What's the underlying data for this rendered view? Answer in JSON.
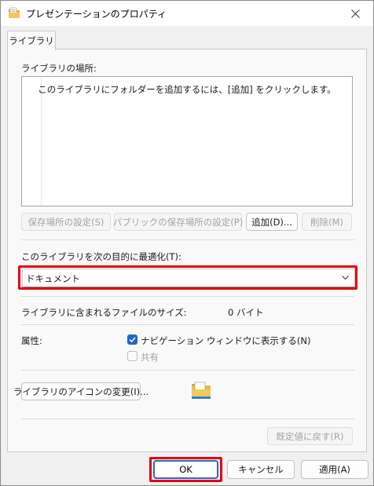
{
  "window": {
    "title": "プレゼンテーションのプロパティ",
    "title_icon": "folder-properties-icon",
    "close_icon": "close-icon"
  },
  "tab": {
    "label": "ライブラリ"
  },
  "library_locations": {
    "label": "ライブラリの場所:",
    "empty_hint": "このライブラリにフォルダーを追加するには、[追加] をクリックします。",
    "buttons": {
      "set_save_location": "保存場所の設定(S)",
      "set_public_save_location": "パブリックの保存場所の設定(P)",
      "add": "追加(D)...",
      "remove": "削除(M)"
    }
  },
  "optimize": {
    "label": "このライブラリを次の目的に最適化(T):",
    "selected": "ドキュメント"
  },
  "size": {
    "label": "ライブラリに含まれるファイルのサイズ:",
    "value": "0 バイト"
  },
  "attributes": {
    "label": "属性:",
    "show_in_nav": {
      "label": "ナビゲーション ウィンドウに表示する(N)",
      "checked": true
    },
    "shared": {
      "label": "共有",
      "checked": false
    }
  },
  "icon_change": {
    "label": "ライブラリのアイコンの変更(I)..."
  },
  "restore_defaults": {
    "label": "既定値に戻す(R)"
  },
  "footer": {
    "ok": "OK",
    "cancel": "キャンセル",
    "apply": "適用(A)"
  },
  "colors": {
    "highlight": "#e60012",
    "accent": "#1f68c4"
  }
}
